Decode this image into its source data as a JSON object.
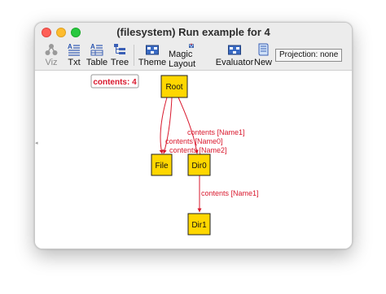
{
  "window": {
    "title": "(filesystem) Run example for 4"
  },
  "toolbar": {
    "items": [
      {
        "label": "Viz",
        "icon": "viz-icon",
        "enabled": false
      },
      {
        "label": "Txt",
        "icon": "text-view-icon",
        "enabled": true
      },
      {
        "label": "Table",
        "icon": "table-view-icon",
        "enabled": true
      },
      {
        "label": "Tree",
        "icon": "tree-view-icon",
        "enabled": true
      },
      {
        "label": "Theme",
        "icon": "theme-icon",
        "enabled": true
      },
      {
        "label": "Magic Layout",
        "icon": "magic-layout-icon",
        "enabled": true
      },
      {
        "label": "Evaluator",
        "icon": "evaluator-icon",
        "enabled": true
      },
      {
        "label": "New",
        "icon": "new-instance-icon",
        "enabled": true
      }
    ],
    "projection_label": "Projection: none"
  },
  "graph": {
    "counter_label": "contents: 4",
    "nodes": {
      "root": "Root",
      "file": "File",
      "dir0": "Dir0",
      "dir1": "Dir1"
    },
    "edges": {
      "root_dir0": "contents [Name1]",
      "root_file_a": "contents [Name0]",
      "root_file_b": "contents [Name2]",
      "dir0_dir1": "contents [Name1]"
    },
    "colors": {
      "node_fill": "#ffd700",
      "edge": "#d9182d",
      "counter_text": "#d9182d"
    }
  }
}
